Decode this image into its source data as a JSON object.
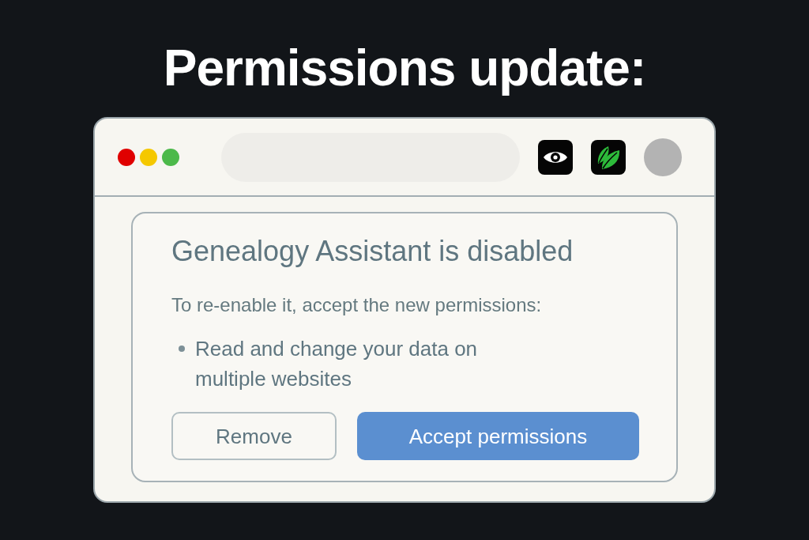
{
  "headline": "Permissions update:",
  "browser_window": {
    "traffic_lights": [
      {
        "color": "#e00000"
      },
      {
        "color": "#f5c800"
      },
      {
        "color": "#4cb94a"
      }
    ],
    "toolbar_icons": [
      {
        "kind": "eye"
      },
      {
        "kind": "leaf"
      },
      {
        "kind": "avatar"
      }
    ]
  },
  "dialog": {
    "title": "Genealogy Assistant is disabled",
    "message": "To re-enable it, accept the new permissions:",
    "permissions": [
      "Read and change your data on multiple websites"
    ],
    "buttons": [
      {
        "label": "Remove",
        "kind": "secondary"
      },
      {
        "label": "Accept permissions",
        "kind": "primary"
      }
    ]
  }
}
